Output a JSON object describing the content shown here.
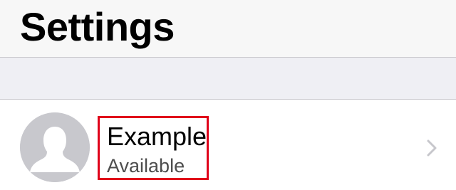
{
  "header": {
    "title": "Settings"
  },
  "profile": {
    "name": "Example",
    "status": "Available",
    "avatar_icon": "person-silhouette-icon",
    "disclosure_icon": "chevron-right-icon"
  },
  "colors": {
    "background": "#f7f7f7",
    "group_separator": "#efeff4",
    "cell_background": "#ffffff",
    "highlight_border": "#e0001a",
    "avatar_fill": "#c8c8cd",
    "chevron": "#c7c7cc"
  }
}
